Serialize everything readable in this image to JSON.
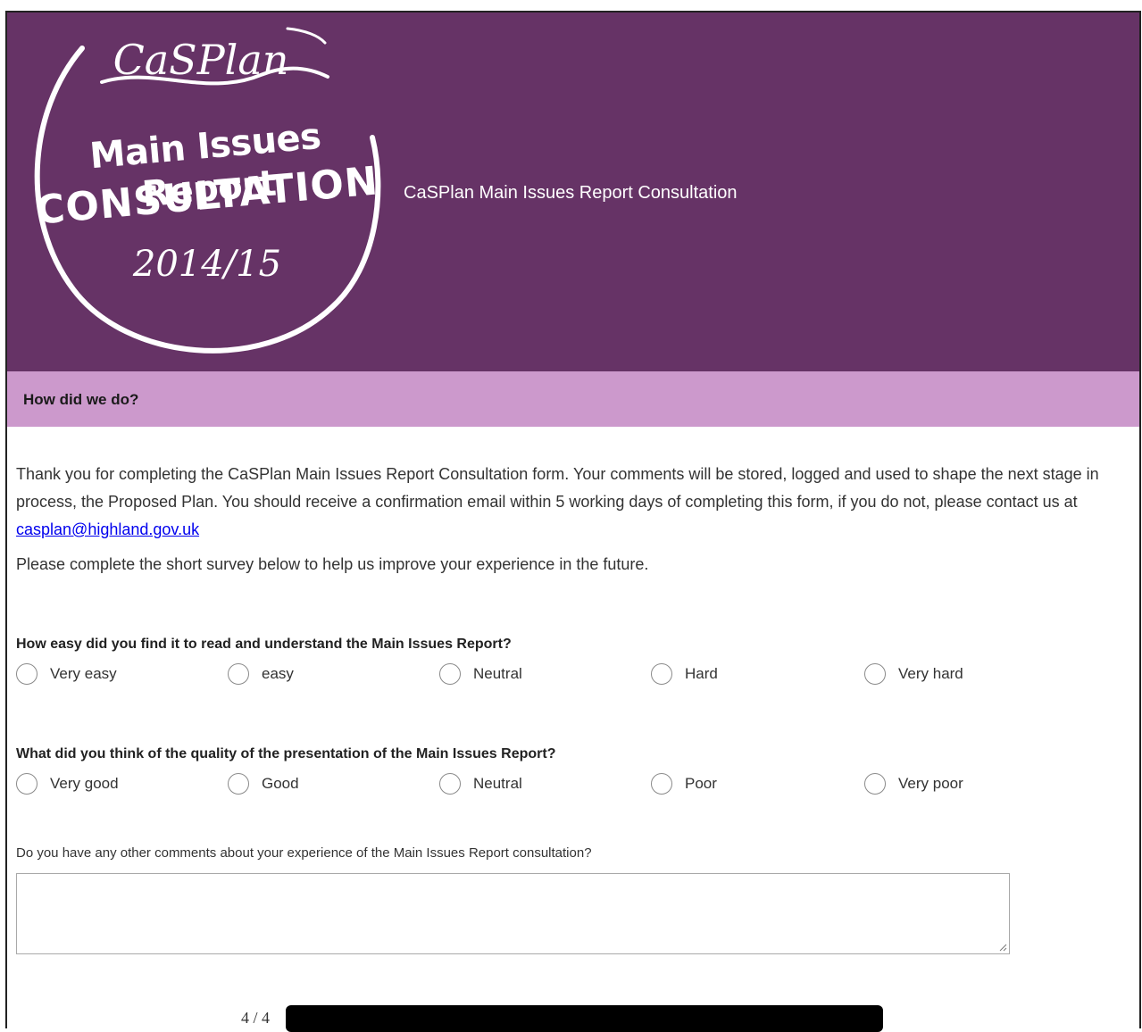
{
  "header": {
    "logo_brand": "CaSPlan",
    "logo_line1": "Main Issues Report",
    "logo_line2": "CONSULTATION",
    "logo_year": "2014/15",
    "title": "CaSPlan Main Issues Report Consultation"
  },
  "section": {
    "title": "How did we do?"
  },
  "intro": {
    "paragraph1_text": "Thank you for completing the CaSPlan Main Issues Report Consultation form. Your comments will be stored, logged and used to shape the next stage in process, the Proposed Plan. You should receive a confirmation email within 5 working days of completing this form, if you do not, please contact us at ",
    "contact_email": "casplan@highland.gov.uk",
    "paragraph2": "Please complete the short survey below to help us improve your experience in the future."
  },
  "questions": [
    {
      "label": "How easy did you find it to read and understand the Main Issues Report?",
      "options": [
        "Very easy",
        "easy",
        "Neutral",
        "Hard",
        "Very hard"
      ]
    },
    {
      "label": "What did you think of the quality of the presentation of the Main Issues Report?",
      "options": [
        "Very good",
        "Good",
        "Neutral",
        "Poor",
        "Very poor"
      ]
    }
  ],
  "comments": {
    "label": "Do you have any other comments about your experience of the Main Issues Report consultation?",
    "value": ""
  },
  "footer": {
    "page_count": "4 / 4"
  },
  "colors": {
    "banner": "#663366",
    "section_bar": "#cc99cc",
    "link": "#0000ee"
  }
}
